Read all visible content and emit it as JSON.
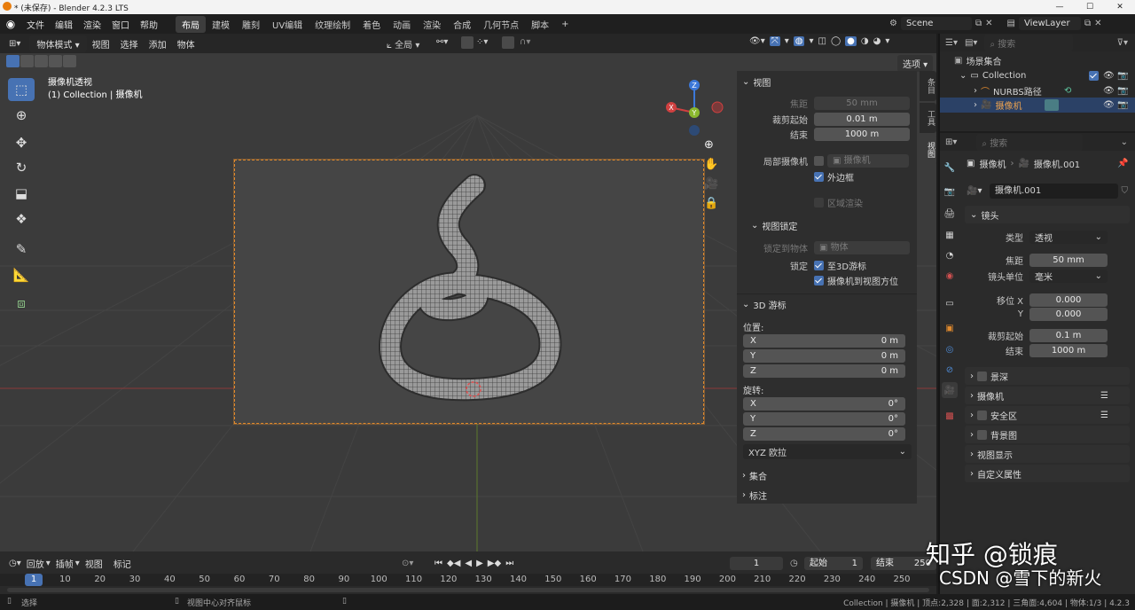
{
  "window": {
    "title": "* (未保存) - Blender 4.2.3 LTS"
  },
  "menus": [
    "文件",
    "编辑",
    "渲染",
    "窗口",
    "帮助"
  ],
  "workspaces": [
    {
      "label": "布局",
      "active": true
    },
    {
      "label": "建模"
    },
    {
      "label": "雕刻"
    },
    {
      "label": "UV编辑"
    },
    {
      "label": "纹理绘制"
    },
    {
      "label": "着色"
    },
    {
      "label": "动画"
    },
    {
      "label": "渲染"
    },
    {
      "label": "合成"
    },
    {
      "label": "几何节点"
    },
    {
      "label": "脚本"
    }
  ],
  "add_workspace": "+",
  "scene": "Scene",
  "view_layer": "ViewLayer",
  "viewport_header": {
    "mode": "物体模式",
    "menus": [
      "视图",
      "选择",
      "添加",
      "物体"
    ],
    "transform_orientation": "全局",
    "options_button": "选项"
  },
  "viewport": {
    "camera_view_title": "摄像机透视",
    "collection_line": "(1) Collection | 摄像机",
    "gizmo": {
      "z": "Z",
      "y": "Y",
      "x": "X"
    }
  },
  "sidebar_tabs": [
    "条目",
    "工具",
    "视图"
  ],
  "npanel": {
    "view_section": "视图",
    "focal_label": "焦距",
    "focal_value": "50 mm",
    "clip_start_label": "裁剪起始",
    "clip_start_value": "0.01 m",
    "clip_end_label": "结束",
    "clip_end_value": "1000 m",
    "local_camera_label": "局部摄像机",
    "local_camera_value": "摄像机",
    "outer_frame": "外边框",
    "region_render": "区域渲染",
    "view_lock_section": "视图锁定",
    "lock_to_object_label": "锁定到物体",
    "lock_to_object_value": "物体",
    "lock_label": "锁定",
    "lock_to_cursor": "至3D游标",
    "camera_to_view": "摄像机到视图方位",
    "cursor_section": "3D 游标",
    "position_label": "位置:",
    "pos": [
      {
        "axis": "X",
        "value": "0 m"
      },
      {
        "axis": "Y",
        "value": "0 m"
      },
      {
        "axis": "Z",
        "value": "0 m"
      }
    ],
    "rotation_label": "旋转:",
    "rot": [
      {
        "axis": "X",
        "value": "0°"
      },
      {
        "axis": "Y",
        "value": "0°"
      },
      {
        "axis": "Z",
        "value": "0°"
      }
    ],
    "rotation_mode": "XYZ 欧拉",
    "collection_section": "集合",
    "annotation_section": "标注"
  },
  "outliner": {
    "search_placeholder": "搜索",
    "scene_collection": "场景集合",
    "items": [
      {
        "label": "Collection"
      },
      {
        "label": "NURBS路径"
      },
      {
        "label": "摄像机"
      }
    ]
  },
  "properties": {
    "search_placeholder": "搜索",
    "breadcrumb_object": "摄像机",
    "breadcrumb_data": "摄像机.001",
    "datablock": "摄像机.001",
    "lens_section": "镜头",
    "type_label": "类型",
    "type_value": "透视",
    "focal_label": "焦距",
    "focal_value": "50 mm",
    "lens_unit_label": "镜头单位",
    "lens_unit_value": "毫米",
    "shift_x_label": "移位 X",
    "shift_x_value": "0.000",
    "shift_y_label": "Y",
    "shift_y_value": "0.000",
    "clip_start_label": "裁剪起始",
    "clip_start_value": "0.1 m",
    "clip_end_label": "结束",
    "clip_end_value": "1000 m",
    "collapsed": [
      "景深",
      "摄像机",
      "安全区",
      "背景图",
      "视图显示",
      "自定义属性"
    ]
  },
  "timeline": {
    "menus": [
      "回放",
      "插帧",
      "视图",
      "标记"
    ],
    "current_frame": "1",
    "start_label": "起始",
    "start_value": "1",
    "end_label": "结束",
    "end_value": "250",
    "ruler": [
      "1",
      "10",
      "20",
      "30",
      "40",
      "50",
      "60",
      "70",
      "80",
      "90",
      "100",
      "110",
      "120",
      "130",
      "140",
      "150",
      "160",
      "170",
      "180",
      "190",
      "200",
      "210",
      "220",
      "230",
      "240",
      "250"
    ]
  },
  "status": {
    "select": "选择",
    "center": "视图中心对齐鼠标",
    "stats": "Collection | 摄像机 | 顶点:2,328 | 面:2,312 | 三角面:4,604 | 物体:1/3 | 4.2.3"
  },
  "watermark": {
    "line1": "知乎 @锁痕",
    "line2": "CSDN @雪下的新火"
  },
  "colors": {
    "accent": "#4772b3",
    "camera_frame": "#e08a2e",
    "selection": "#2b4166"
  }
}
